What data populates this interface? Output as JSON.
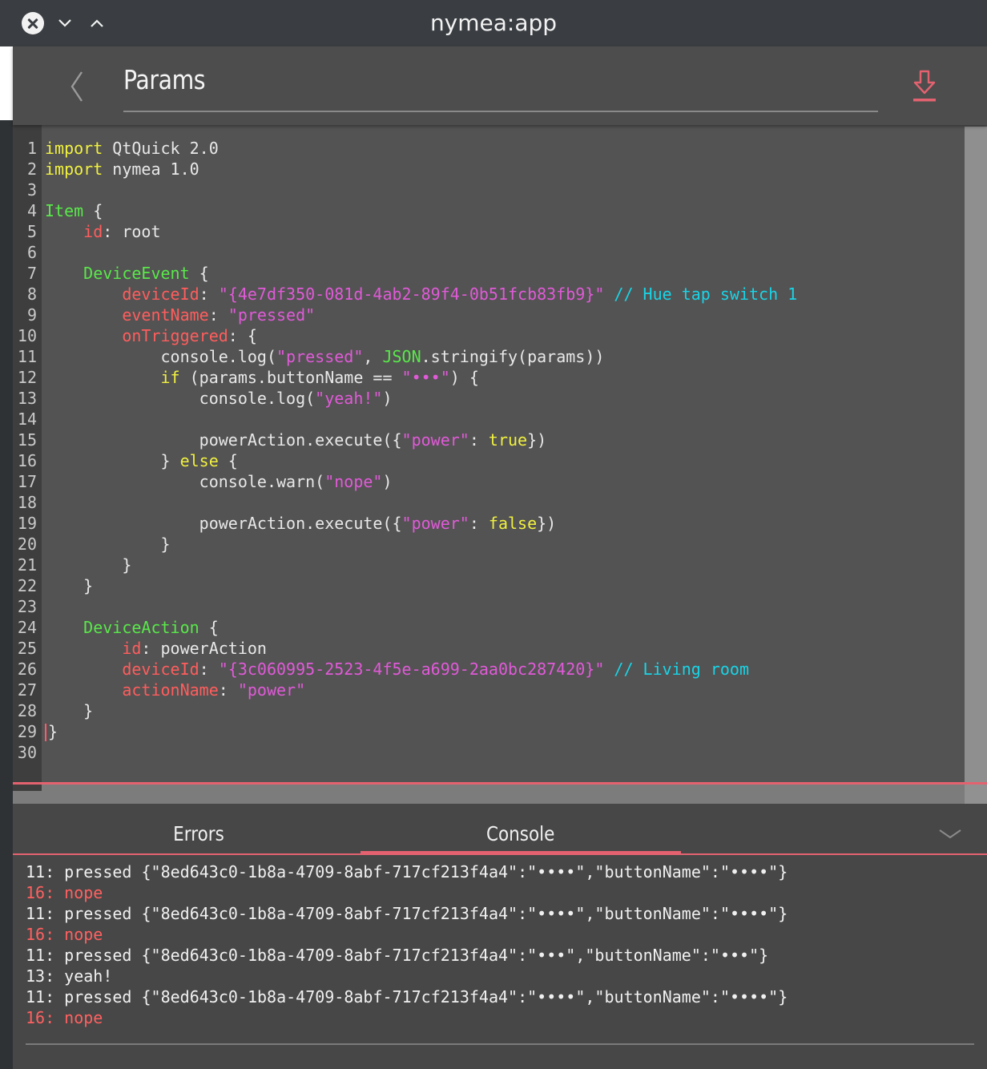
{
  "window": {
    "title": "nymea:app"
  },
  "header": {
    "title": "Params"
  },
  "editor": {
    "line_numbers": [
      "1",
      "2",
      "3",
      "4",
      "5",
      "6",
      "7",
      "8",
      "9",
      "10",
      "11",
      "12",
      "13",
      "14",
      "15",
      "16",
      "17",
      "18",
      "19",
      "20",
      "21",
      "22",
      "23",
      "24",
      "25",
      "26",
      "27",
      "28",
      "29",
      "30"
    ],
    "tokens": [
      {
        "kw": "import",
        "t": " QtQuick 2.0"
      },
      {
        "kw": "import",
        "t": " nymea 1.0"
      },
      {
        "t": ""
      },
      {
        "type": "Item",
        "t": " {"
      },
      {
        "i": "    ",
        "prop": "id",
        "t": ": root"
      },
      {
        "t": ""
      },
      {
        "i": "    ",
        "type": "DeviceEvent",
        "t": " {"
      },
      {
        "i": "        ",
        "prop": "deviceId",
        "t": ": ",
        "str": "\"{4e7df350-081d-4ab2-89f4-0b51fcb83fb9}\"",
        "cm": " // Hue tap switch 1"
      },
      {
        "i": "        ",
        "prop": "eventName",
        "t": ": ",
        "str": "\"pressed\""
      },
      {
        "i": "        ",
        "prop": "onTriggered",
        "t": ": {"
      },
      {
        "i": "            ",
        "t": "console.log(",
        "str": "\"pressed\"",
        "t2": ", ",
        "type2": "JSON",
        "t3": ".stringify(params))"
      },
      {
        "i": "            ",
        "kw": "if",
        "t": " (params.buttonName == ",
        "str": "\"•••\"",
        "t2": ") {"
      },
      {
        "i": "                ",
        "t": "console.log(",
        "str": "\"yeah!\"",
        "t2": ")"
      },
      {
        "t": ""
      },
      {
        "i": "                ",
        "t": "powerAction.execute({",
        "str": "\"power\"",
        "t2": ": ",
        "kw2": "true",
        "t3": "})"
      },
      {
        "i": "            ",
        "t": "} ",
        "kw2": "else",
        "t3": " {"
      },
      {
        "i": "                ",
        "t": "console.warn(",
        "str": "\"nope\"",
        "t2": ")"
      },
      {
        "t": ""
      },
      {
        "i": "                ",
        "t": "powerAction.execute({",
        "str": "\"power\"",
        "t2": ": ",
        "kw2": "false",
        "t3": "})"
      },
      {
        "i": "            ",
        "t": "}"
      },
      {
        "i": "        ",
        "t": "}"
      },
      {
        "i": "    ",
        "t": "}"
      },
      {
        "t": ""
      },
      {
        "i": "    ",
        "type": "DeviceAction",
        "t": " {"
      },
      {
        "i": "        ",
        "prop": "id",
        "t": ": powerAction"
      },
      {
        "i": "        ",
        "prop": "deviceId",
        "t": ": ",
        "str": "\"{3c060995-2523-4f5e-a699-2aa0bc287420}\"",
        "cm": " // Living room"
      },
      {
        "i": "        ",
        "prop": "actionName",
        "t": ": ",
        "str": "\"power\""
      },
      {
        "i": "    ",
        "t": "}"
      },
      {
        "caret": true,
        "t": "}"
      },
      {
        "t": ""
      }
    ]
  },
  "tabs": [
    {
      "label": "Errors"
    },
    {
      "label": "Console"
    }
  ],
  "console": {
    "lines": [
      {
        "text": "11: pressed {\"8ed643c0-1b8a-4709-8abf-717cf213f4a4\":\"••••\",\"buttonName\":\"••••\"}",
        "level": "log"
      },
      {
        "text": "16: nope",
        "level": "warn"
      },
      {
        "text": "11: pressed {\"8ed643c0-1b8a-4709-8abf-717cf213f4a4\":\"••••\",\"buttonName\":\"••••\"}",
        "level": "log"
      },
      {
        "text": "16: nope",
        "level": "warn"
      },
      {
        "text": "11: pressed {\"8ed643c0-1b8a-4709-8abf-717cf213f4a4\":\"•••\",\"buttonName\":\"•••\"}",
        "level": "log"
      },
      {
        "text": "13: yeah!",
        "level": "log"
      },
      {
        "text": "11: pressed {\"8ed643c0-1b8a-4709-8abf-717cf213f4a4\":\"••••\",\"buttonName\":\"••••\"}",
        "level": "log"
      },
      {
        "text": "16: nope",
        "level": "warn"
      }
    ]
  },
  "colors": {
    "accent": "#e46270",
    "keyword": "#f0f040",
    "type": "#59e84a",
    "property": "#ff5d5d",
    "string": "#e05ad8",
    "comment": "#19d4e6"
  },
  "icons": {
    "close": "close-icon",
    "minimize": "chevron-down-icon",
    "maximize": "chevron-up-icon",
    "back": "back-chevron-icon",
    "download": "download-icon",
    "collapse": "chevron-down-icon"
  }
}
